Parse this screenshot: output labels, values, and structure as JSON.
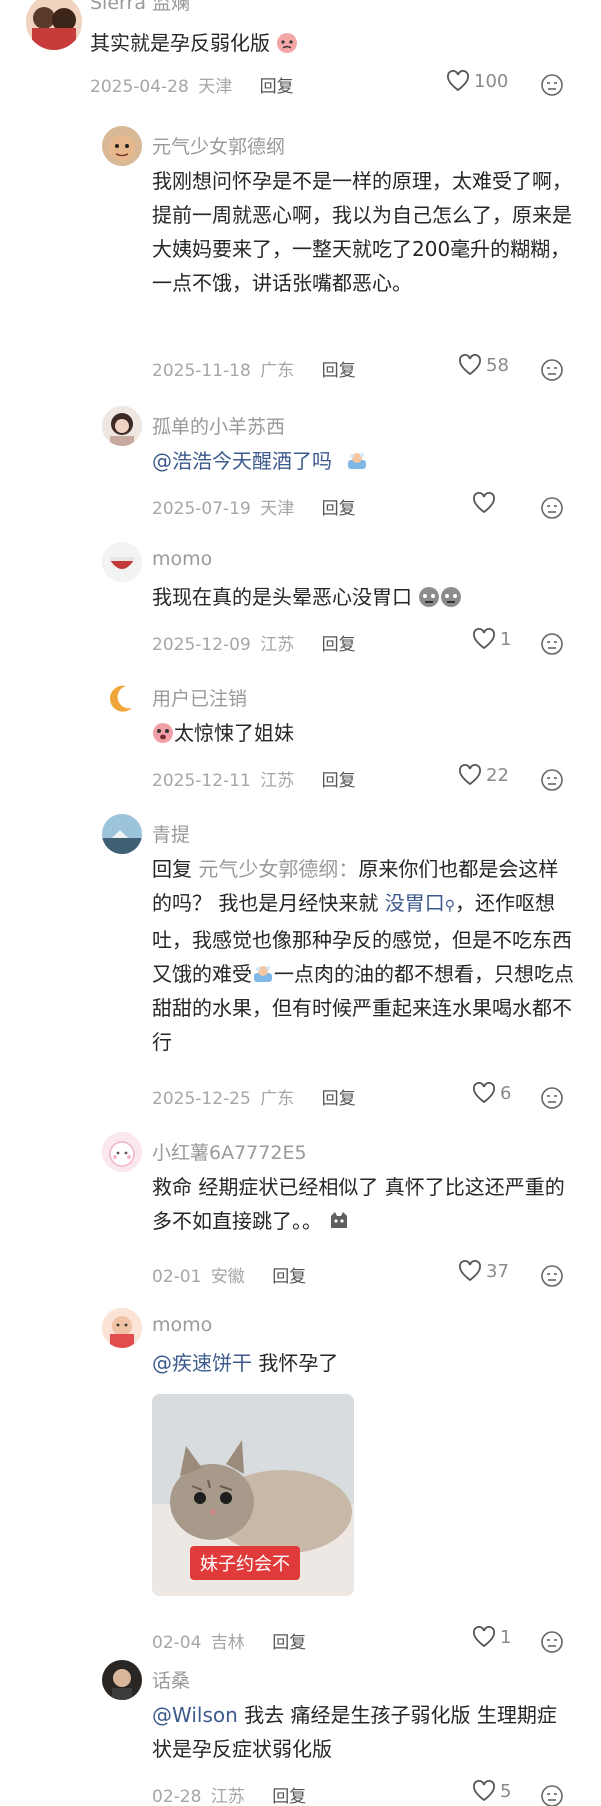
{
  "comments": [
    {
      "name": "Sierra 监斓",
      "text": "其实就是孕反弱化版",
      "date": "2025-04-28",
      "location": "天津",
      "reply_label": "回复",
      "likes": "100"
    },
    {
      "name": "元气少女郭德纲",
      "text": "我刚想问怀孕是不是一样的原理，太难受了啊，提前一周就恶心啊，我以为自己怎么了，原来是大姨妈要来了，一整天就吃了200毫升的糊糊，一点不饿，讲话张嘴都恶心。",
      "date": "2025-11-18",
      "location": "广东",
      "reply_label": "回复",
      "likes": "58"
    },
    {
      "name": "孤单的小羊苏西",
      "mention": "@浩浩今天醒酒了吗",
      "date": "2025-07-19",
      "location": "天津",
      "reply_label": "回复",
      "likes": ""
    },
    {
      "name": "momo",
      "text": "我现在真的是头晕恶心没胃口",
      "date": "2025-12-09",
      "location": "江苏",
      "reply_label": "回复",
      "likes": "1"
    },
    {
      "name": "用户已注销",
      "text": "太惊悚了姐妹",
      "date": "2025-12-11",
      "location": "江苏",
      "reply_label": "回复",
      "likes": "22"
    },
    {
      "name": "青提",
      "reply_prefix": "回复",
      "reply_target": "元气少女郭德纲：",
      "text_a": "原来你们也都是会这样的吗？ 我也是月经快来就",
      "link": "没胃口",
      "text_b": "，还作呕想吐，我感觉也像那种孕反的感觉，但是不吃东西又饿的难受",
      "text_c": "一点肉的油的都不想看，只想吃点甜甜的水果，但有时候严重起来连水果喝水都不行",
      "date": "2025-12-25",
      "location": "广东",
      "reply_label": "回复",
      "likes": "6"
    },
    {
      "name": "小红薯6A7772E5",
      "text": "救命 经期症状已经相似了 真怀了比这还严重的多不如直接跳了。。",
      "date": "02-01",
      "location": "安徽",
      "reply_label": "回复",
      "likes": "37"
    },
    {
      "name": "momo",
      "mention": "@疾速饼干",
      "text": " 我怀孕了",
      "image_caption": "妹子约会不",
      "date": "02-04",
      "location": "吉林",
      "reply_label": "回复",
      "likes": "1"
    },
    {
      "name": "话桑",
      "mention": "@Wilson",
      "text": " 我去 痛经是生孩子弱化版 生理期症状是孕反症状弱化版",
      "date": "02-28",
      "location": "江苏",
      "reply_label": "回复",
      "likes": "5"
    }
  ],
  "colors": {
    "meta": "#a6a6a6",
    "mention": "#3c5a8c",
    "caption_bg": "#e03a3a"
  }
}
